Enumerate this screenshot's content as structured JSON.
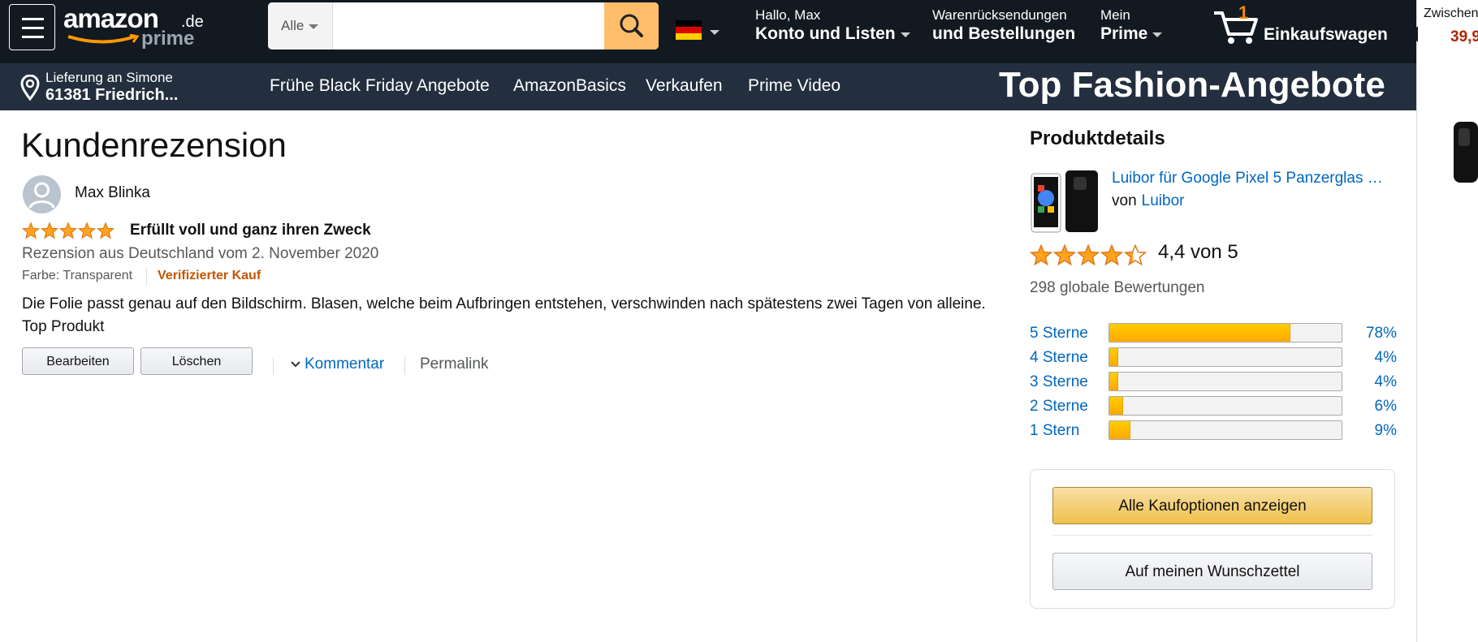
{
  "header": {
    "logo_text": "amazon",
    "logo_tld": ".de",
    "logo_prime": "prime",
    "search": {
      "category": "Alle",
      "placeholder": "",
      "value": ""
    },
    "greeting": "Hallo, Max",
    "account_label": "Konto und Listen",
    "returns_line1": "Warenrücksendungen",
    "returns_line2": "und Bestellungen",
    "prime_line1": "Mein",
    "prime_line2": "Prime",
    "cart_count": "1",
    "cart_label": "Einkaufswagen"
  },
  "subnav": {
    "delivery_line1": "Lieferung an Simone",
    "delivery_line2": "61381 Friedrich...",
    "links": [
      "Frühe Black Friday Angebote",
      "AmazonBasics",
      "Verkaufen",
      "Prime Video"
    ],
    "promo": "Top Fashion-Angebote"
  },
  "review": {
    "page_title": "Kundenrezension",
    "author": "Max Blinka",
    "rating": 5,
    "title": "Erfüllt voll und ganz ihren Zweck",
    "date_line": "Rezension aus Deutschland vom 2. November 2020",
    "variant": "Farbe: Transparent",
    "verified": "Verifizierter Kauf",
    "body": "Die Folie passt genau auf den Bildschirm. Blasen, welche beim Aufbringen entstehen, verschwinden nach spätestens zwei Tagen von alleine. Top Produkt",
    "edit_label": "Bearbeiten",
    "delete_label": "Löschen",
    "comment_label": "Kommentar",
    "permalink_label": "Permalink"
  },
  "product": {
    "section_title": "Produktdetails",
    "name": "Luibor für Google Pixel 5 Panzerglas …",
    "by_label": "von",
    "brand": "Luibor",
    "avg_rating": 4.4,
    "avg_text": "4,4 von 5",
    "global_ratings": "298 globale Bewertungen",
    "histogram": [
      {
        "label": "5 Sterne",
        "percent": 78,
        "percent_text": "78%"
      },
      {
        "label": "4 Sterne",
        "percent": 4,
        "percent_text": "4%"
      },
      {
        "label": "3 Sterne",
        "percent": 4,
        "percent_text": "4%"
      },
      {
        "label": "2 Sterne",
        "percent": 6,
        "percent_text": "6%"
      },
      {
        "label": "1 Stern",
        "percent": 9,
        "percent_text": "9%"
      }
    ],
    "buy_label": "Alle Kaufoptionen anzeigen",
    "wishlist_label": "Auf meinen Wunschzettel"
  },
  "side_panel": {
    "subtotal_label": "Zwischen",
    "subtotal_price": "39,9"
  },
  "colors": {
    "header_bg": "#131921",
    "subnav_bg": "#232f3e",
    "link": "#0066c0",
    "star": "#ffa41c",
    "verified": "#c45500",
    "price": "#b12704"
  }
}
